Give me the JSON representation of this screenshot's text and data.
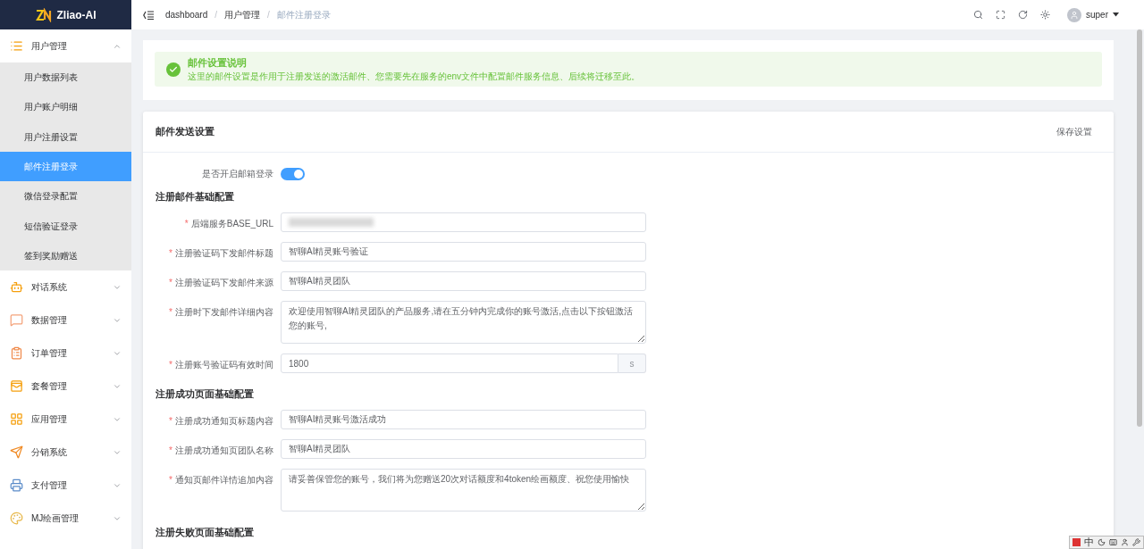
{
  "logo": {
    "text": "Zliao-AI"
  },
  "sidebar": {
    "groups": [
      {
        "label": "用户管理",
        "expanded": true,
        "children": [
          {
            "label": "用户数据列表",
            "selected": false
          },
          {
            "label": "用户账户明细",
            "selected": false
          },
          {
            "label": "用户注册设置",
            "selected": false
          },
          {
            "label": "邮件注册登录",
            "selected": true
          },
          {
            "label": "微信登录配置",
            "selected": false
          },
          {
            "label": "短信验证登录",
            "selected": false
          },
          {
            "label": "签到奖励赠送",
            "selected": false
          }
        ]
      },
      {
        "label": "对话系统",
        "expanded": false
      },
      {
        "label": "数据管理",
        "expanded": false
      },
      {
        "label": "订单管理",
        "expanded": false
      },
      {
        "label": "套餐管理",
        "expanded": false
      },
      {
        "label": "应用管理",
        "expanded": false
      },
      {
        "label": "分销系统",
        "expanded": false
      },
      {
        "label": "支付管理",
        "expanded": false
      },
      {
        "label": "MJ绘画管理",
        "expanded": false
      }
    ]
  },
  "breadcrumb": {
    "separator": "/",
    "items": [
      "dashboard",
      "用户管理",
      "邮件注册登录"
    ]
  },
  "user": {
    "name": "super"
  },
  "notice": {
    "title": "邮件设置说明",
    "text": "这里的邮件设置是作用于注册发送的激活邮件、您需要先在服务的env文件中配置邮件服务信息、后续将迁移至此。"
  },
  "form": {
    "title": "邮件发送设置",
    "save_button": "保存设置",
    "required_mark": "*",
    "toggle": {
      "label": "是否开启邮箱登录",
      "on": true
    },
    "sections": [
      {
        "title": "注册邮件基础配置",
        "fields": [
          {
            "kind": "blurred",
            "label": "后端服务BASE_URL"
          },
          {
            "kind": "input",
            "label": "注册验证码下发邮件标题",
            "value": "智聊AI精灵账号验证"
          },
          {
            "kind": "input",
            "label": "注册验证码下发邮件来源",
            "value": "智聊AI精灵团队"
          },
          {
            "kind": "textarea",
            "label": "注册时下发邮件详细内容",
            "value": "欢迎使用智聊AI精灵团队的产品服务,请在五分钟内完成你的账号激活,点击以下按钮激活您的账号,"
          },
          {
            "kind": "suffix",
            "label": "注册账号验证码有效时间",
            "value": "1800",
            "suffix": "s"
          }
        ]
      },
      {
        "title": "注册成功页面基础配置",
        "fields": [
          {
            "kind": "input",
            "label": "注册成功通知页标题内容",
            "value": "智聊AI精灵账号激活成功"
          },
          {
            "kind": "input",
            "label": "注册成功通知页团队名称",
            "value": "智聊AI精灵团队"
          },
          {
            "kind": "textarea",
            "label": "通知页邮件详情追加内容",
            "value": "请妥善保管您的账号，我们将为您赠送20次对话额度和4token绘画额度、祝您使用愉快"
          }
        ]
      },
      {
        "title": "注册失败页面基础配置"
      }
    ]
  },
  "ime_bar": {
    "mode": "中"
  }
}
